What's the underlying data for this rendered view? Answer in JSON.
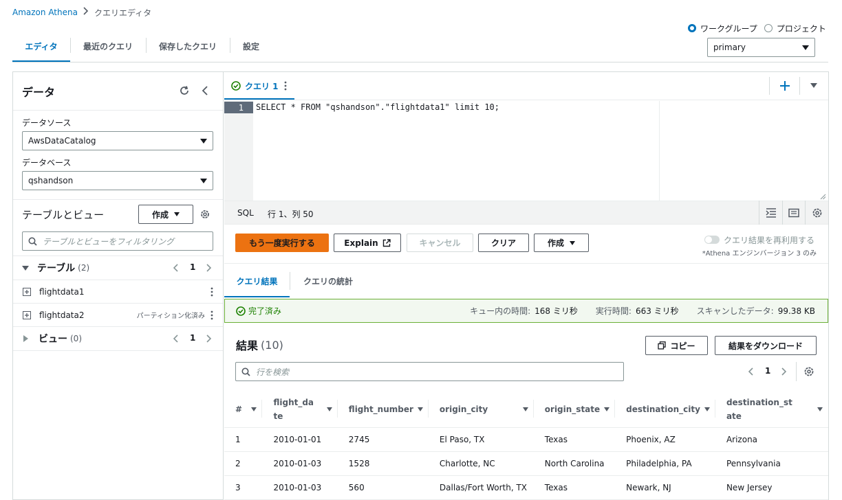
{
  "breadcrumb": {
    "root": "Amazon Athena",
    "current": "クエリエディタ"
  },
  "top_tabs": [
    "エディタ",
    "最近のクエリ",
    "保存したクエリ",
    "設定"
  ],
  "workgroup": {
    "radio_workgroup": "ワークグループ",
    "radio_project": "プロジェクト",
    "selected": "primary"
  },
  "data_panel": {
    "title": "データ",
    "datasource_label": "データソース",
    "datasource_value": "AwsDataCatalog",
    "database_label": "データベース",
    "database_value": "qshandson",
    "tables_views_title": "テーブルとビュー",
    "create_button": "作成",
    "filter_placeholder": "テーブルとビューをフィルタリング",
    "tables_section": {
      "label": "テーブル",
      "count": "(2)",
      "page": "1"
    },
    "tables": [
      {
        "name": "flightdata1",
        "badge": ""
      },
      {
        "name": "flightdata2",
        "badge": "パーティション化済み"
      }
    ],
    "views_section": {
      "label": "ビュー",
      "count": "(0)",
      "page": "1"
    }
  },
  "editor": {
    "tab_label": "クエリ 1",
    "line_number": "1",
    "query": "SELECT * FROM \"qshandson\".\"flightdata1\" limit 10;",
    "status_lang": "SQL",
    "status_pos": "行 1、列 50"
  },
  "actions": {
    "run_again": "もう一度実行する",
    "explain": "Explain",
    "cancel": "キャンセル",
    "clear": "クリア",
    "create": "作成",
    "reuse_toggle": "クエリ結果を再利用する",
    "reuse_note": "*Athena エンジンバージョン 3 のみ"
  },
  "result_tabs": [
    "クエリ結果",
    "クエリの統計"
  ],
  "status_bar": {
    "status": "完了済み",
    "queue_label": "キュー内の時間:",
    "queue_value": "168 ミリ秒",
    "exec_label": "実行時間:",
    "exec_value": "663 ミリ秒",
    "scan_label": "スキャンしたデータ:",
    "scan_value": "99.38 KB"
  },
  "results": {
    "title": "結果",
    "count": "(10)",
    "copy": "コピー",
    "download": "結果をダウンロード",
    "search_placeholder": "行を検索",
    "page": "1",
    "columns": [
      "#",
      "flight_date",
      "flight_number",
      "origin_city",
      "origin_state",
      "destination_city",
      "destination_state"
    ],
    "rows": [
      [
        "1",
        "2010-01-01",
        "2745",
        "El Paso, TX",
        "Texas",
        "Phoenix, AZ",
        "Arizona"
      ],
      [
        "2",
        "2010-01-03",
        "1528",
        "Charlotte, NC",
        "North Carolina",
        "Philadelphia, PA",
        "Pennsylvania"
      ],
      [
        "3",
        "2010-01-03",
        "560",
        "Dallas/Fort Worth, TX",
        "Texas",
        "Newark, NJ",
        "New Jersey"
      ]
    ]
  },
  "colors": {
    "accent": "#0073bb",
    "primary_button": "#ec7211",
    "success": "#1d8102"
  }
}
